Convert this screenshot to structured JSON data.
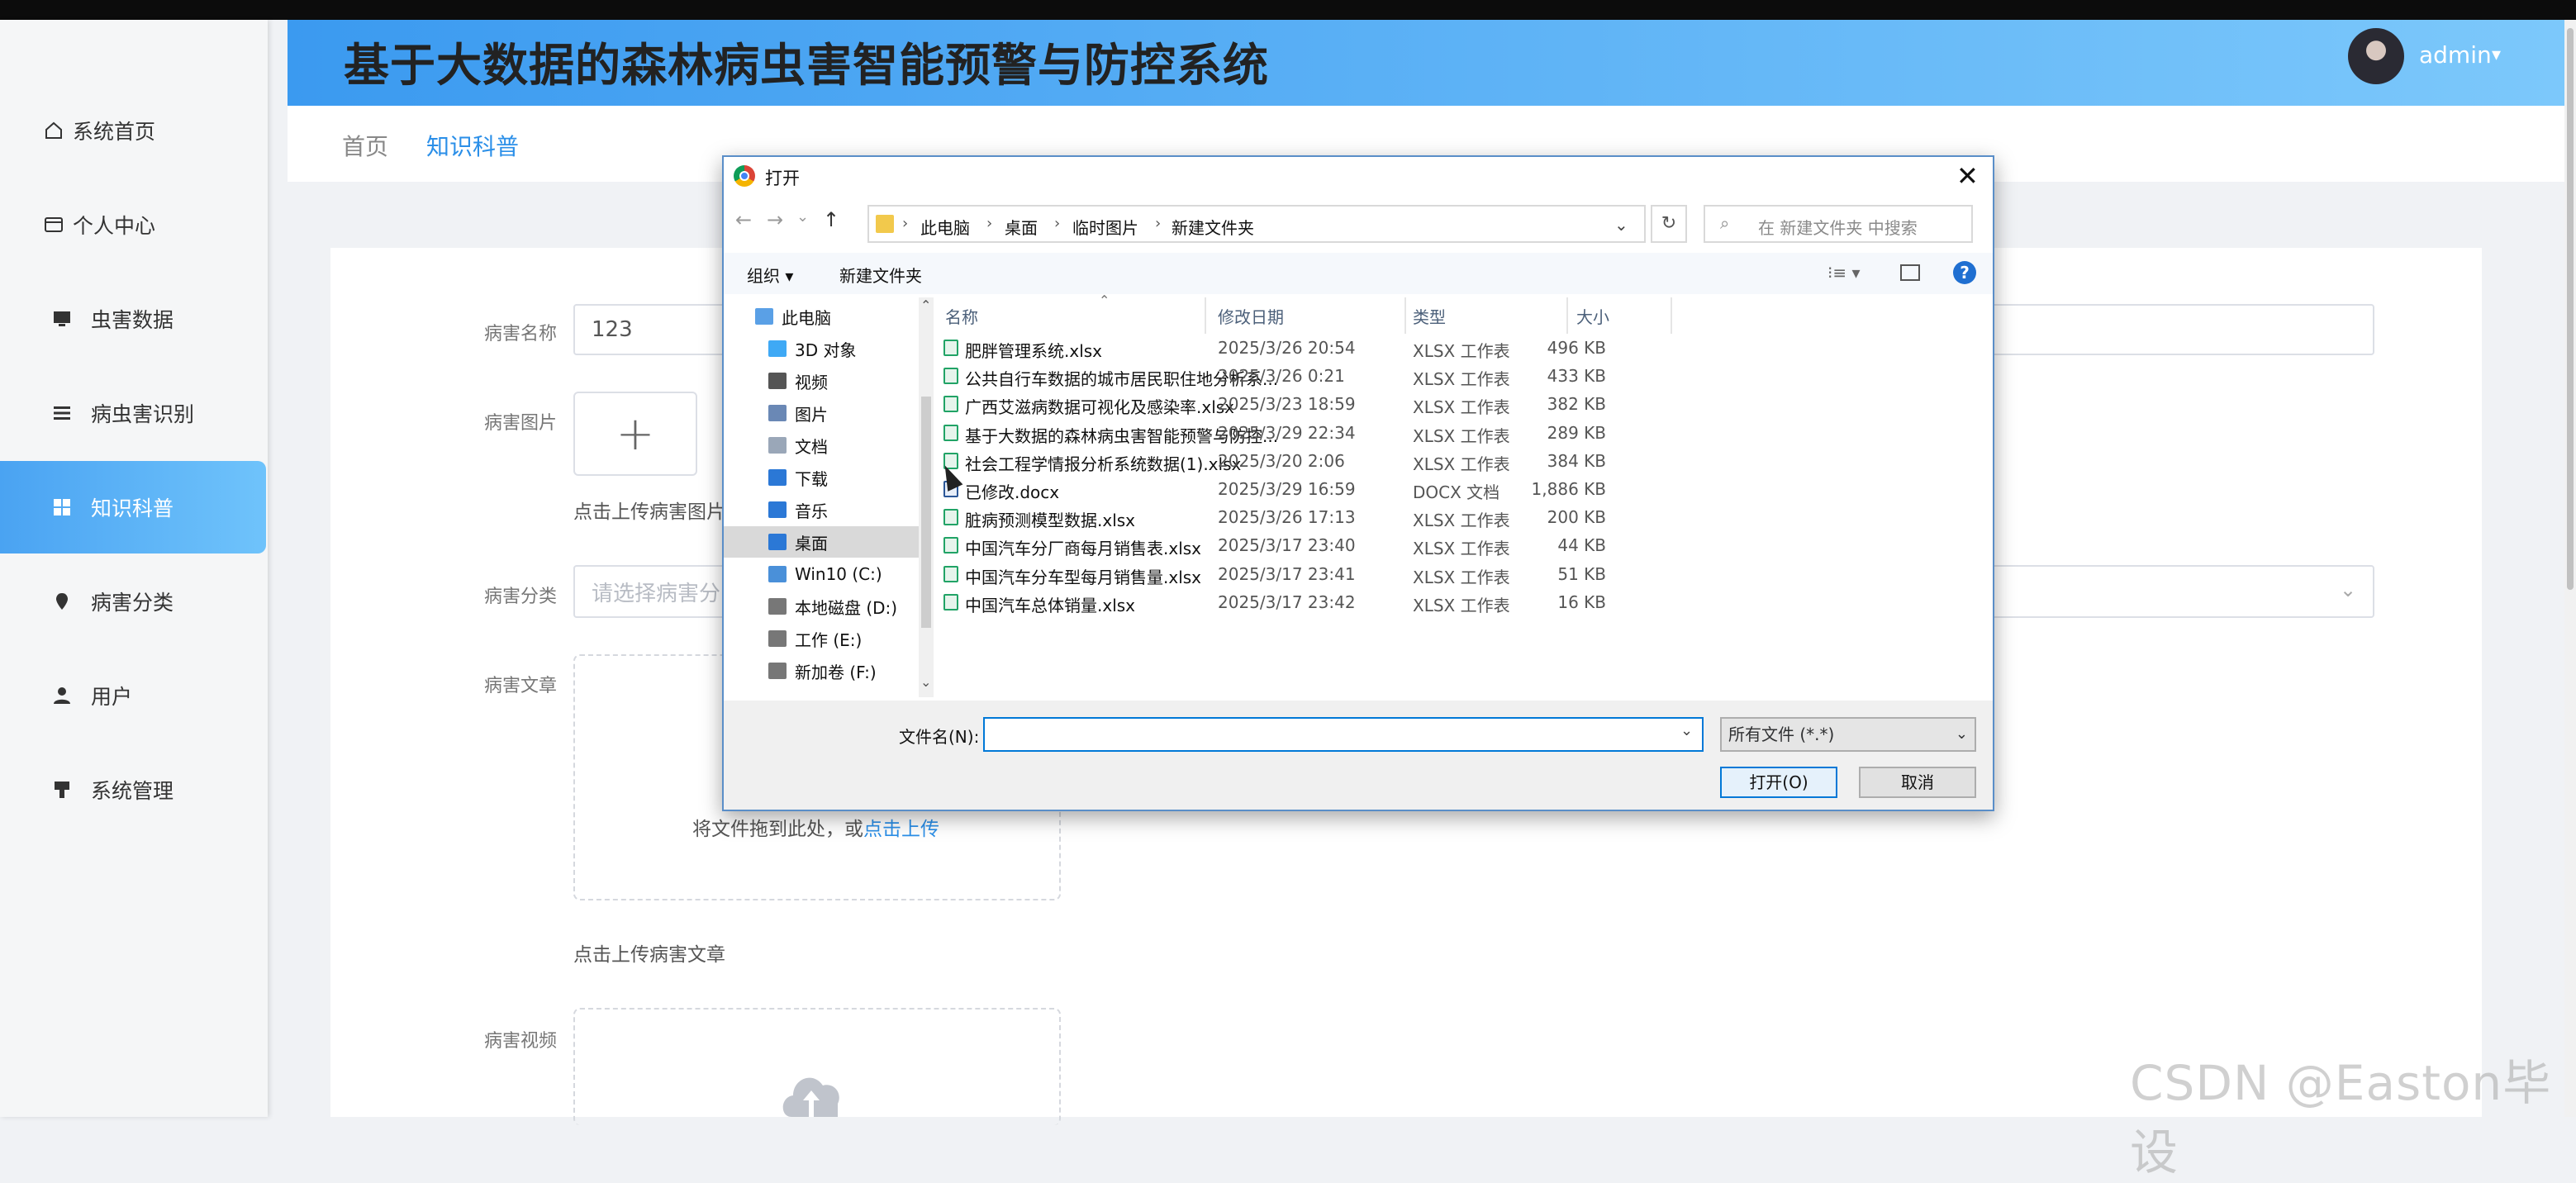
{
  "app": {
    "title": "基于大数据的森林病虫害智能预警与防控系统",
    "user": "admin",
    "caret": "▾"
  },
  "sidebar": {
    "items": [
      {
        "label": "系统首页",
        "icon": "home-icon"
      },
      {
        "label": "个人中心",
        "icon": "card-icon"
      },
      {
        "label": "虫害数据",
        "icon": "monitor-icon"
      },
      {
        "label": "病虫害识别",
        "icon": "list-icon"
      },
      {
        "label": "知识科普",
        "icon": "grid-icon",
        "active": true
      },
      {
        "label": "病害分类",
        "icon": "pin-icon"
      },
      {
        "label": "用户",
        "icon": "user-icon"
      },
      {
        "label": "系统管理",
        "icon": "stamp-icon"
      }
    ]
  },
  "breadcrumb": {
    "home": "首页",
    "current": "知识科普"
  },
  "form": {
    "name_label": "病害名称",
    "name_value": "123",
    "image_label": "病害图片",
    "plus": "+",
    "image_hint": "点击上传病害图片",
    "category_label": "病害分类",
    "category_placeholder": "请选择病害分",
    "article_label": "病害文章",
    "drop_text": "将文件拖到此处，或",
    "drop_link": "点击上传",
    "article_hint": "点击上传病害文章",
    "video_label": "病害视频"
  },
  "dialog": {
    "title": "打开",
    "close": "✕",
    "nav": {
      "back": "←",
      "forward": "→",
      "down": "⌄",
      "up": "↑"
    },
    "path": [
      "此电脑",
      "桌面",
      "临时图片",
      "新建文件夹"
    ],
    "path_sep": "›",
    "refresh": "↻",
    "search_placeholder": "在 新建文件夹 中搜索",
    "organize": "组织 ▾",
    "new_folder": "新建文件夹",
    "view_icon": "⁝≡ ▾",
    "help": "?",
    "tree": [
      {
        "label": "此电脑",
        "color": "#5aa0e6"
      },
      {
        "label": "3D 对象",
        "color": "#3fa9f5"
      },
      {
        "label": "视频",
        "color": "#555"
      },
      {
        "label": "图片",
        "color": "#6a88b5"
      },
      {
        "label": "文档",
        "color": "#9aa7b8"
      },
      {
        "label": "下载",
        "color": "#2b78d6"
      },
      {
        "label": "音乐",
        "color": "#2b78d6"
      },
      {
        "label": "桌面",
        "color": "#2b78d6",
        "selected": true
      },
      {
        "label": "Win10 (C:)",
        "color": "#4a90d9"
      },
      {
        "label": "本地磁盘 (D:)",
        "color": "#777"
      },
      {
        "label": "工作 (E:)",
        "color": "#777"
      },
      {
        "label": "新加卷 (F:)",
        "color": "#777"
      }
    ],
    "columns": {
      "name": "名称",
      "modified": "修改日期",
      "type": "类型",
      "size": "大小"
    },
    "files": [
      {
        "name": "肥胖管理系统.xlsx",
        "date": "2025/3/26 20:54",
        "type": "XLSX 工作表",
        "size": "496 KB"
      },
      {
        "name": "公共自行车数据的城市居民职住地分析系...",
        "date": "2025/3/26 0:21",
        "type": "XLSX 工作表",
        "size": "433 KB"
      },
      {
        "name": "广西艾滋病数据可视化及感染率.xlsx",
        "date": "2025/3/23 18:59",
        "type": "XLSX 工作表",
        "size": "382 KB"
      },
      {
        "name": "基于大数据的森林病虫害智能预警与防控...",
        "date": "2025/3/29 22:34",
        "type": "XLSX 工作表",
        "size": "289 KB"
      },
      {
        "name": "社会工程学情报分析系统数据(1).xlsx",
        "date": "2025/3/20 2:06",
        "type": "XLSX 工作表",
        "size": "384 KB"
      },
      {
        "name": "已修改.docx",
        "date": "2025/3/29 16:59",
        "type": "DOCX 文档",
        "size": "1,886 KB",
        "doc": true
      },
      {
        "name": "脏病预测模型数据.xlsx",
        "date": "2025/3/26 17:13",
        "type": "XLSX 工作表",
        "size": "200 KB"
      },
      {
        "name": "中国汽车分厂商每月销售表.xlsx",
        "date": "2025/3/17 23:40",
        "type": "XLSX 工作表",
        "size": "44 KB"
      },
      {
        "name": "中国汽车分车型每月销售量.xlsx",
        "date": "2025/3/17 23:41",
        "type": "XLSX 工作表",
        "size": "51 KB"
      },
      {
        "name": "中国汽车总体销量.xlsx",
        "date": "2025/3/17 23:42",
        "type": "XLSX 工作表",
        "size": "16 KB"
      }
    ],
    "filename_label": "文件名(N):",
    "filename_value": "",
    "filter": "所有文件 (*.*)",
    "open": "打开(O)",
    "cancel": "取消"
  },
  "watermark": "CSDN @Easton毕设"
}
